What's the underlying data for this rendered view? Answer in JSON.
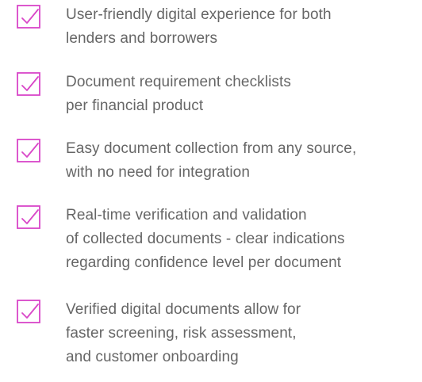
{
  "colors": {
    "accent": "#d946c8",
    "text": "#666666",
    "background": "#ffffff"
  },
  "features": [
    {
      "icon": "checkbox-check-icon",
      "lines": [
        "User-friendly digital experience for both",
        "lenders and borrowers"
      ]
    },
    {
      "icon": "checkbox-check-icon",
      "lines": [
        "Document requirement checklists",
        "per financial product"
      ]
    },
    {
      "icon": "checkbox-check-icon",
      "lines": [
        "Easy document collection from any source,",
        "with no need for integration"
      ]
    },
    {
      "icon": "checkbox-check-icon",
      "lines": [
        "Real-time verification and validation",
        "of collected documents - clear indications",
        "regarding confidence level per document"
      ]
    },
    {
      "icon": "checkbox-check-icon",
      "lines": [
        "Verified digital documents allow for",
        "faster screening, risk assessment,",
        "and customer onboarding"
      ]
    }
  ]
}
